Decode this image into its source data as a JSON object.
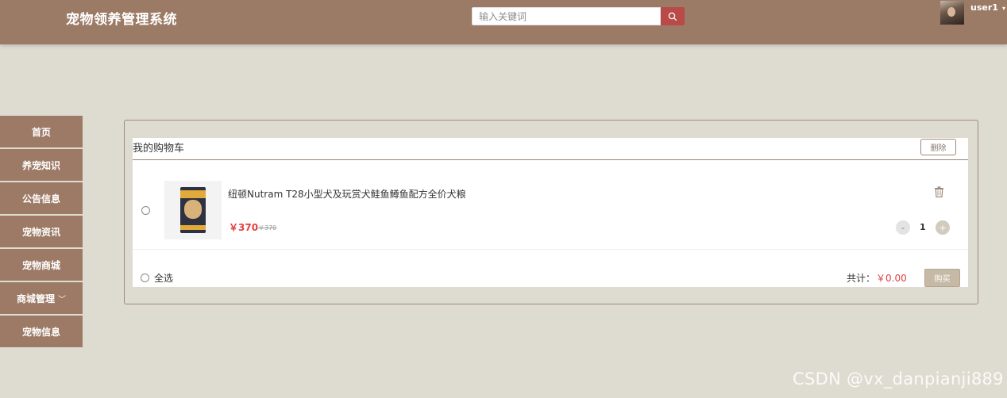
{
  "header": {
    "app_title": "宠物领养管理系统",
    "search_placeholder": "输入关键词",
    "username": "user1",
    "background_color": "#9b7b66",
    "search_button_color": "#b94a48"
  },
  "sidebar": {
    "items": [
      {
        "label": "首页"
      },
      {
        "label": "养宠知识"
      },
      {
        "label": "公告信息"
      },
      {
        "label": "宠物资讯"
      },
      {
        "label": "宠物商城"
      },
      {
        "label": "商城管理",
        "has_submenu": true
      },
      {
        "label": "宠物信息"
      }
    ]
  },
  "cart": {
    "title": "我的购物车",
    "delete_label": "删除",
    "items": [
      {
        "name": "纽顿Nutram T28小型犬及玩赏犬鲑鱼鳟鱼配方全价犬粮",
        "price": "￥370",
        "original_price": "￥370",
        "quantity": "1",
        "minus_label": "-",
        "plus_label": "+"
      }
    ],
    "select_all_label": "全选",
    "total_label": "共计：",
    "total_value": "￥0.00",
    "buy_label": "购买",
    "price_color": "#e04141"
  },
  "watermark": "CSDN @vx_danpianji889"
}
